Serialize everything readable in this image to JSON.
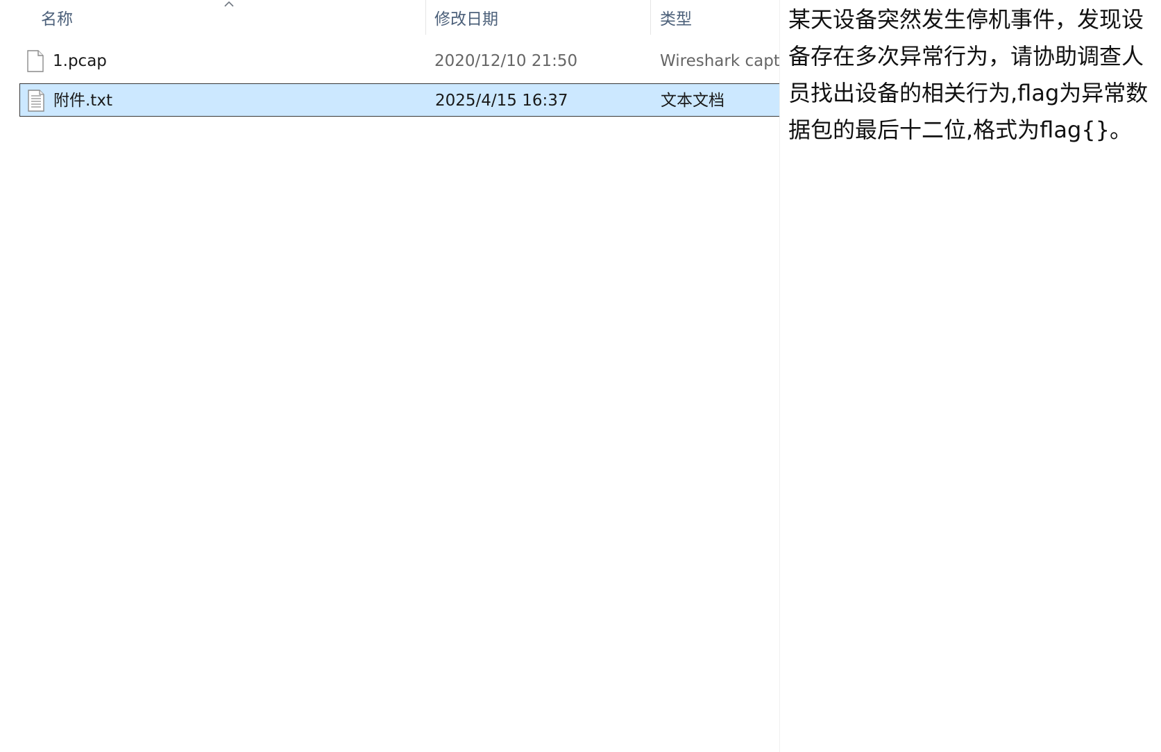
{
  "columns": {
    "name": "名称",
    "date_modified": "修改日期",
    "type": "类型"
  },
  "files": [
    {
      "name": "1.pcap",
      "date_modified": "2020/12/10 21:50",
      "type": "Wireshark capt",
      "icon": "blank-file-icon"
    },
    {
      "name": "附件.txt",
      "date_modified": "2025/4/15 16:37",
      "type": "文本文档",
      "icon": "text-file-icon",
      "selected": true
    }
  ],
  "preview": {
    "text": "某天设备突然发生停机事件，发现设备存在多次异常行为，请协助调查人员找出设备的相关行为,flag为异常数据包的最后十二位,格式为flag{}。"
  },
  "colors": {
    "selection_bg": "#cce8ff",
    "selection_border": "#353535",
    "header_text": "#4c607a"
  }
}
